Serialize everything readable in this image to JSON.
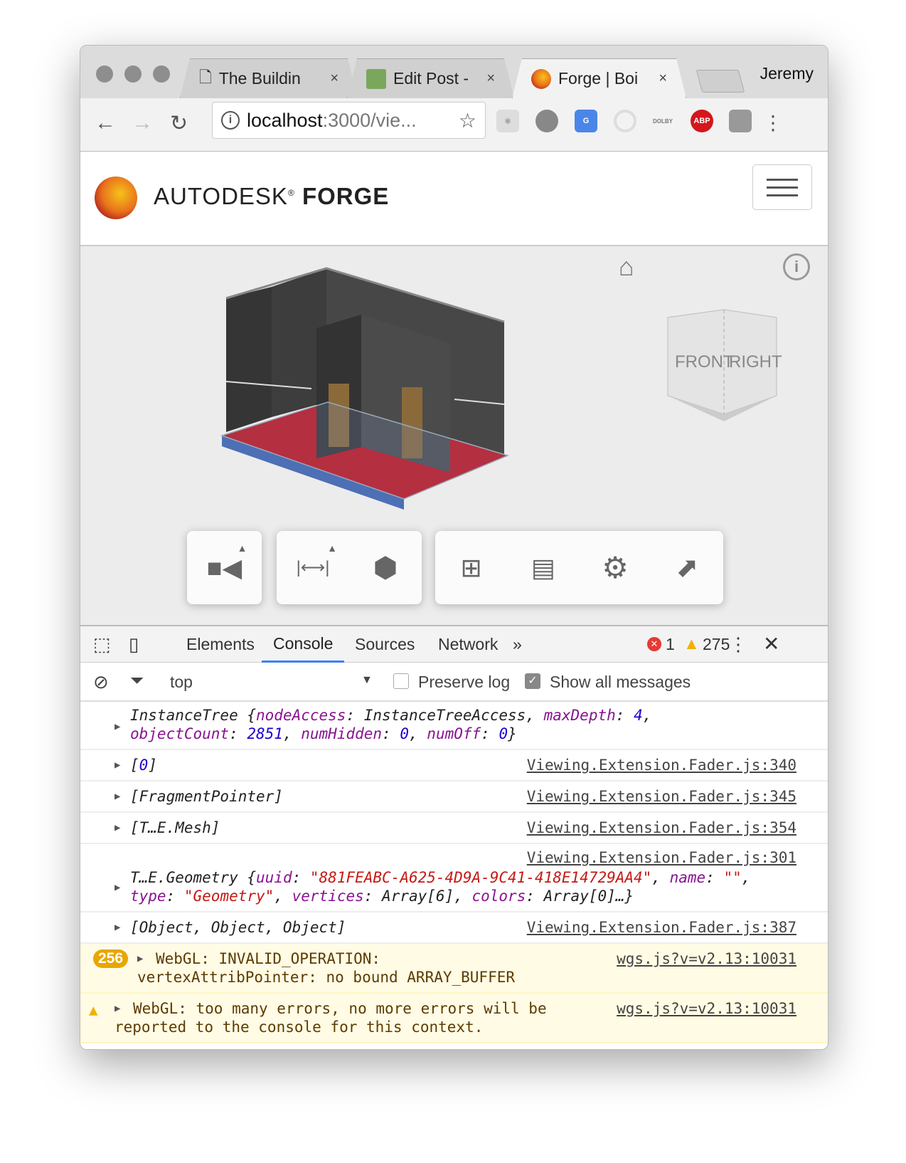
{
  "browser": {
    "tabs": [
      {
        "title": "The Buildin",
        "icon": "document-icon"
      },
      {
        "title": "Edit Post -",
        "icon": "blog-icon"
      },
      {
        "title": "Forge | Boi",
        "icon": "forge-icon",
        "active": true
      }
    ],
    "close_glyph": "×",
    "user": "Jeremy",
    "url_host": "localhost",
    "url_path": ":3000/vie...",
    "extensions": [
      "react-icon",
      "fire-icon",
      "translate-icon",
      "ring-icon",
      "dolby-icon",
      "adblock-icon",
      "shield-icon"
    ],
    "abp_label": "ABP",
    "dolby_label": "DOLBY"
  },
  "app": {
    "brand_prefix": "AUTODESK",
    "brand_reg": "®",
    "brand_name": "FORGE"
  },
  "viewer": {
    "cube_front": "FRONT",
    "cube_right": "RIGHT",
    "toolbar": [
      "camera",
      "measure",
      "explode",
      "model-browser",
      "properties",
      "settings",
      "fullscreen"
    ],
    "colors": {
      "floor": "#c8101a",
      "slab": "#4d6fb5",
      "wall": "#474747"
    }
  },
  "devtools": {
    "tabs": [
      "Elements",
      "Console",
      "Sources",
      "Network"
    ],
    "more": "»",
    "error_count": "1",
    "warning_count": "275",
    "context": "top",
    "preserve_log": "Preserve log",
    "preserve_checked": false,
    "show_all": "Show all messages",
    "show_all_checked": true
  },
  "console": {
    "rows": [
      {
        "src": "",
        "parts": [
          "InstanceTree {",
          "nodeAccess",
          ": InstanceTreeAccess, ",
          "maxDepth",
          ": ",
          "4",
          ",",
          "objectCount",
          ": ",
          "2851",
          ", ",
          "numHidden",
          ": ",
          "0",
          ", ",
          "numOff",
          ": ",
          "0",
          "}"
        ]
      },
      {
        "src": "Viewing.Extension.Fader.js:340",
        "pre": "[",
        "val": "0",
        "post": "]"
      },
      {
        "src": "Viewing.Extension.Fader.js:345",
        "text": "[FragmentPointer]"
      },
      {
        "src": "Viewing.Extension.Fader.js:354",
        "text": "[T…E.Mesh]"
      },
      {
        "src": "Viewing.Extension.Fader.js:301",
        "parts": [
          "T…E.Geometry {",
          "uuid",
          ": ",
          "\"881FEABC-A625-4D9A-9C41-418E14729AA4\"",
          ", ",
          "name",
          ": ",
          "\"\"",
          ",",
          "type",
          ": ",
          "\"Geometry\"",
          ", ",
          "vertices",
          ": Array[6], ",
          "colors",
          ": Array[0]…}"
        ]
      },
      {
        "src": "Viewing.Extension.Fader.js:387",
        "text": "[Object, Object, Object]"
      }
    ],
    "warnings": [
      {
        "count": "256",
        "line1": "WebGL: INVALID_OPERATION:",
        "line2": "vertexAttribPointer: no bound ARRAY_BUFFER",
        "src": "wgs.js?v=v2.13:10031"
      },
      {
        "line1": "WebGL: too many errors, no more errors will be",
        "line2": "reported to the console for this context.",
        "src": "wgs.js?v=v2.13:10031"
      }
    ],
    "prompt": "›"
  }
}
